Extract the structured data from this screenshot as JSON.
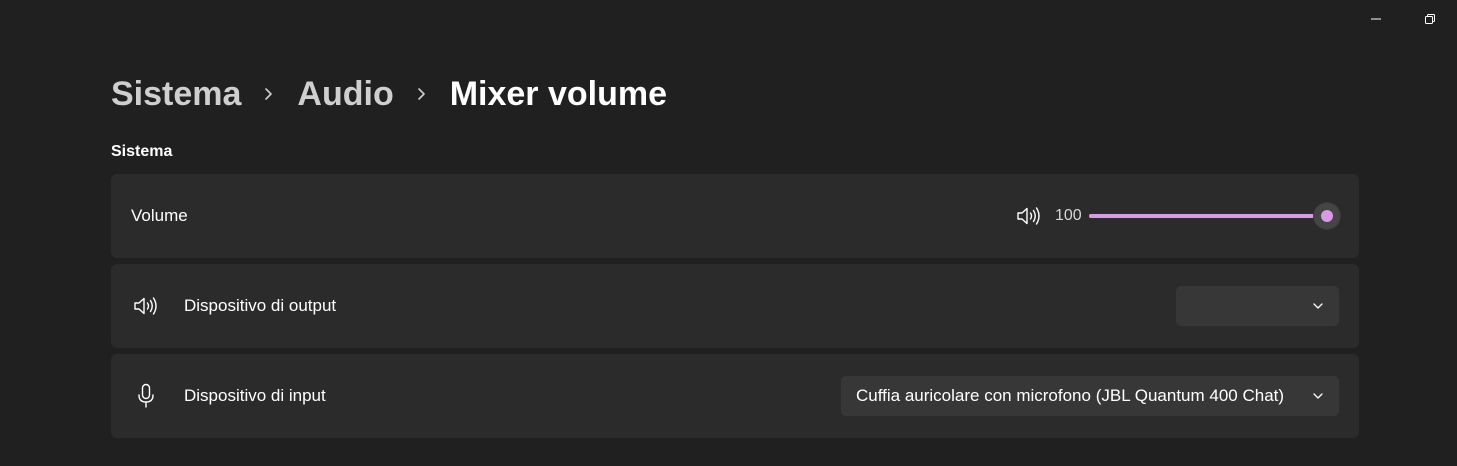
{
  "breadcrumb": {
    "items": [
      {
        "label": "Sistema"
      },
      {
        "label": "Audio"
      },
      {
        "label": "Mixer volume"
      }
    ]
  },
  "section": {
    "title": "Sistema"
  },
  "volume": {
    "label": "Volume",
    "value": "100",
    "level_percent": 100,
    "icon": "speaker-icon"
  },
  "output": {
    "label": "Dispositivo di output",
    "selected": "",
    "icon": "speaker-icon"
  },
  "input": {
    "label": "Dispositivo di input",
    "selected": "Cuffia auricolare con microfono (JBL Quantum 400 Chat)",
    "icon": "microphone-icon"
  },
  "colors": {
    "background": "#202020",
    "card": "#2b2b2b",
    "accent": "#d69ae6",
    "dropdown": "#373737"
  }
}
